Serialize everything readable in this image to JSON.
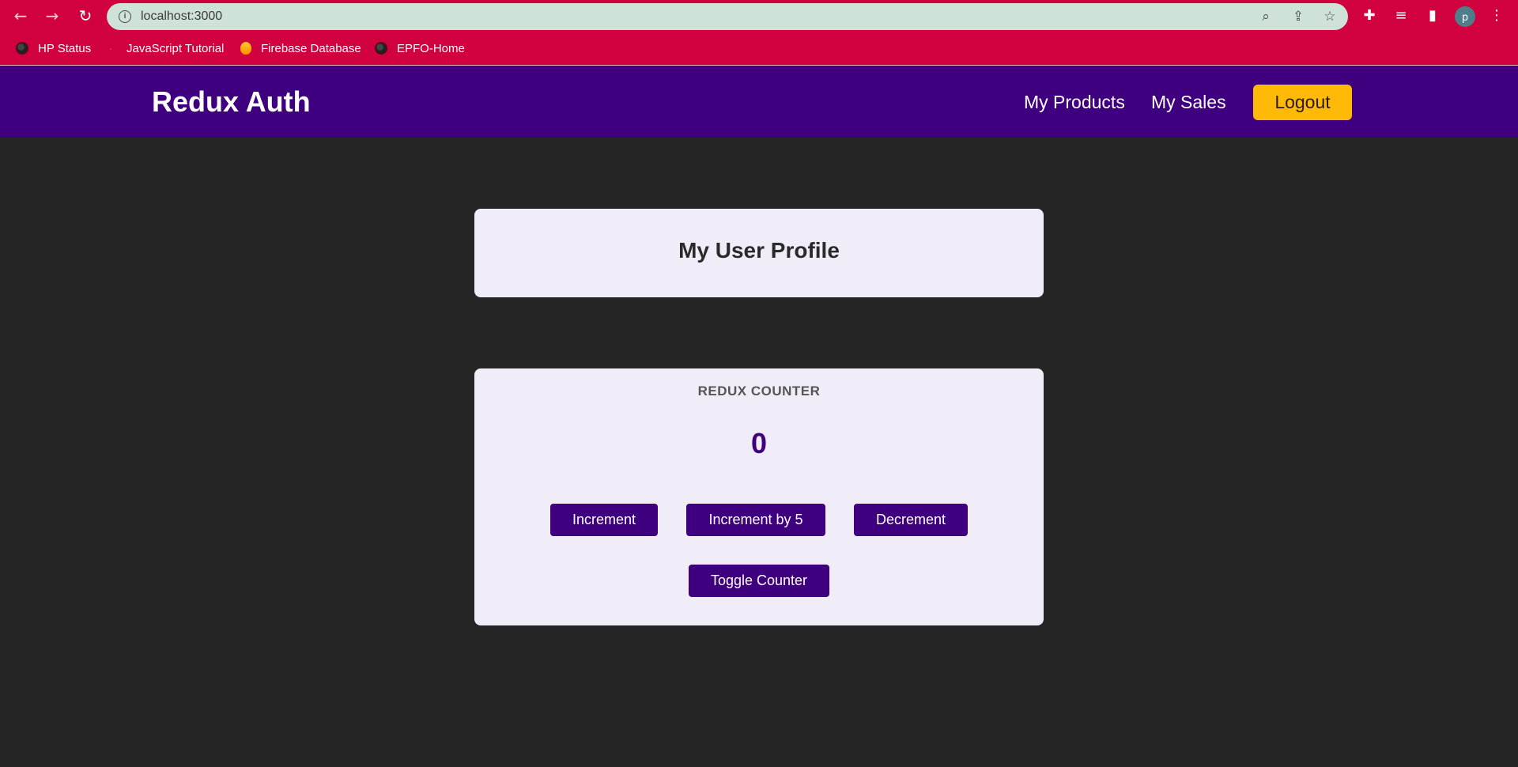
{
  "browser": {
    "url": "localhost:3000",
    "bookmarks": [
      {
        "label": "HP Status",
        "icon": "globe-icon"
      },
      {
        "label": "JavaScript Tutorial",
        "icon": "js-icon"
      },
      {
        "label": "Firebase Database",
        "icon": "firebase-icon"
      },
      {
        "label": "EPFO-Home",
        "icon": "globe-icon"
      }
    ],
    "profile_initial": "p",
    "theme_color": "#d1003f"
  },
  "header": {
    "brand": "Redux Auth",
    "nav": [
      "My Products",
      "My Sales"
    ],
    "logout_label": "Logout",
    "bg_color": "#3f0080",
    "accent_color": "#ffba08"
  },
  "profile": {
    "title": "My User Profile"
  },
  "counter": {
    "title": "REDUX COUNTER",
    "value": "0",
    "buttons": {
      "increment": "Increment",
      "increment5": "Increment by 5",
      "decrement": "Decrement",
      "toggle": "Toggle Counter"
    }
  }
}
